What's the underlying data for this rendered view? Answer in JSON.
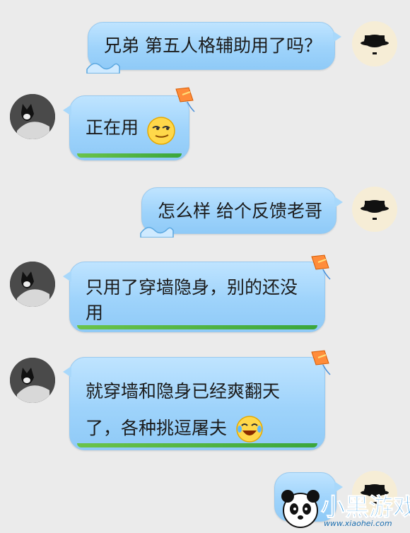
{
  "messages": [
    {
      "id": 1,
      "side": "right",
      "text": "兄弟 第五人格辅助用了吗？",
      "avatar": "hat-icon"
    },
    {
      "id": 2,
      "side": "left",
      "text": "正在用",
      "emoji": "smirk-emoji-icon",
      "avatar": "husky-icon"
    },
    {
      "id": 3,
      "side": "right",
      "text": "怎么样 给个反馈老哥",
      "avatar": "hat-icon"
    },
    {
      "id": 4,
      "side": "left",
      "lines": [
        "只用了穿墙隐身，别的还没",
        "用"
      ],
      "avatar": "husky-icon"
    },
    {
      "id": 5,
      "side": "left",
      "lines": [
        "就穿墙和隐身已经爽翻天",
        "了，各种挑逗屠夫"
      ],
      "emoji": "laugh-cry-emoji-icon",
      "avatar": "husky-icon"
    },
    {
      "id": 6,
      "side": "right",
      "text": "",
      "avatar": "hat-icon"
    }
  ],
  "watermark": {
    "brand": "小黑游戏",
    "url": "www.xiaohei.com"
  }
}
